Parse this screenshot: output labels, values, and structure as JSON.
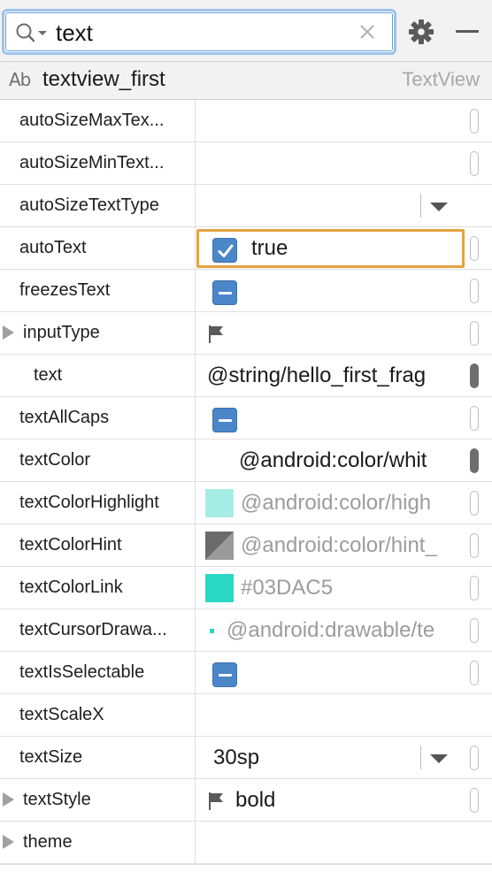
{
  "search": {
    "value": "text",
    "placeholder": ""
  },
  "header": {
    "icon": "Ab",
    "component_id": "textview_first",
    "component_type": "TextView"
  },
  "toolbar": {
    "settings_icon": "gear-icon",
    "minimize_icon": "minimize-icon"
  },
  "colors": {
    "accent_blue": "#4a86c8",
    "focus_orange": "#e2a340",
    "textColorHighlight_swatch": "#a6ede6",
    "textColorLink_swatch": "#2ad7c5"
  },
  "properties": [
    {
      "name": "autoSizeMaxTex...",
      "value": ""
    },
    {
      "name": "autoSizeMinText...",
      "value": ""
    },
    {
      "name": "autoSizeTextType",
      "value": ""
    },
    {
      "name": "autoText",
      "value": "true"
    },
    {
      "name": "freezesText",
      "value": ""
    },
    {
      "name": "inputType",
      "value": ""
    },
    {
      "name": "text",
      "value": "@string/hello_first_frag"
    },
    {
      "name": "textAllCaps",
      "value": ""
    },
    {
      "name": "textColor",
      "value": "@android:color/whit"
    },
    {
      "name": "textColorHighlight",
      "value": "@android:color/high"
    },
    {
      "name": "textColorHint",
      "value": "@android:color/hint_"
    },
    {
      "name": "textColorLink",
      "value": "#03DAC5"
    },
    {
      "name": "textCursorDrawa...",
      "value": "@android:drawable/te"
    },
    {
      "name": "textIsSelectable",
      "value": ""
    },
    {
      "name": "textScaleX",
      "value": ""
    },
    {
      "name": "textSize",
      "value": "30sp"
    },
    {
      "name": "textStyle",
      "value": "bold"
    },
    {
      "name": "theme",
      "value": ""
    }
  ]
}
